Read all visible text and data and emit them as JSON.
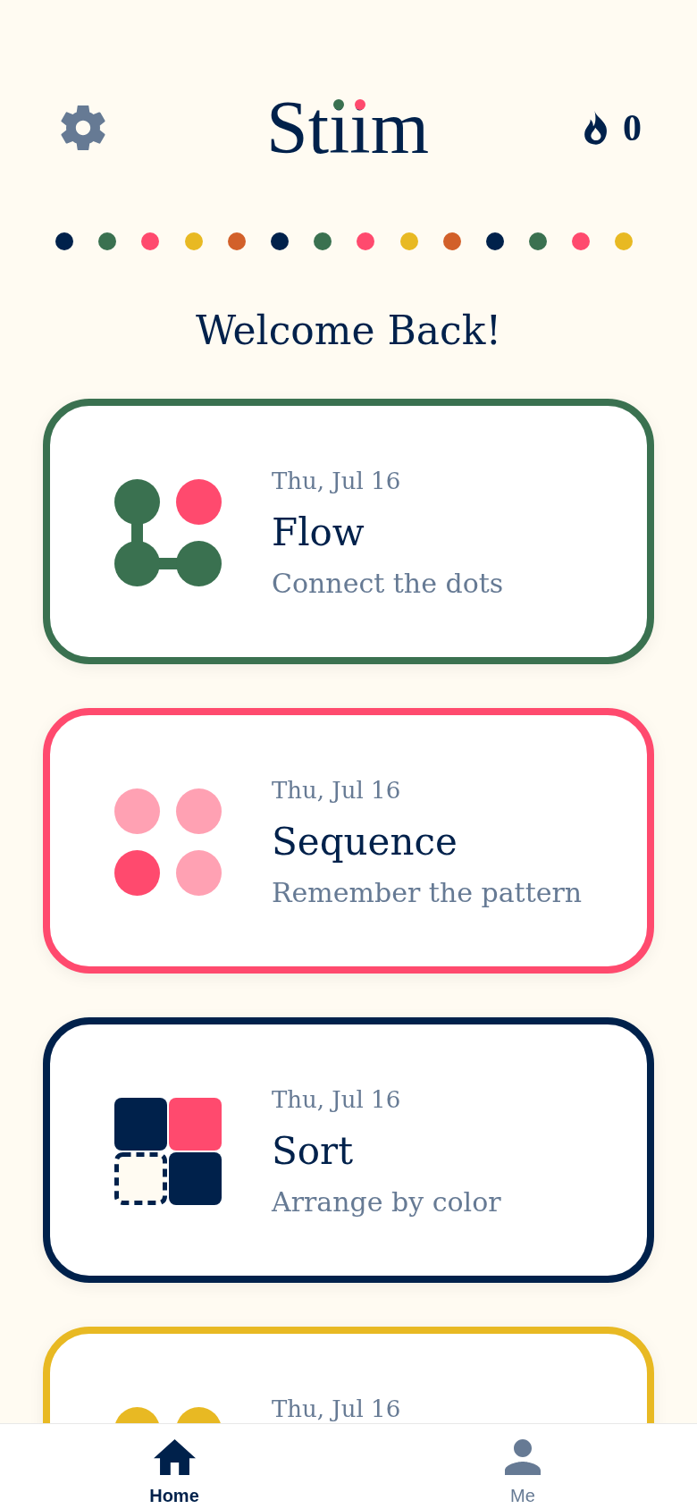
{
  "header": {
    "logo": "Stiim",
    "streak_count": "0"
  },
  "color_dots": [
    {
      "color": "#00214b"
    },
    {
      "color": "#3a7150"
    },
    {
      "color": "#ff4a6e"
    },
    {
      "color": "#e8b923"
    },
    {
      "color": "#d2602a"
    },
    {
      "color": "#00214b"
    },
    {
      "color": "#3a7150"
    },
    {
      "color": "#ff4a6e"
    },
    {
      "color": "#e8b923"
    },
    {
      "color": "#d2602a"
    },
    {
      "color": "#00214b"
    },
    {
      "color": "#3a7150"
    },
    {
      "color": "#ff4a6e"
    },
    {
      "color": "#e8b923"
    }
  ],
  "greeting": "Welcome Back!",
  "cards": [
    {
      "kind": "flow",
      "color": "#3a7150",
      "date": "Thu, Jul 16",
      "title": "Flow",
      "subtitle": "Connect the dots"
    },
    {
      "kind": "sequence",
      "color": "#ff4a6e",
      "date": "Thu, Jul 16",
      "title": "Sequence",
      "subtitle": "Remember the pattern"
    },
    {
      "kind": "sort",
      "color": "#00214b",
      "date": "Thu, Jul 16",
      "title": "Sort",
      "subtitle": "Arrange by color"
    },
    {
      "kind": "dots",
      "color": "#e8b923",
      "date": "Thu, Jul 16"
    }
  ],
  "bottom_nav": [
    {
      "kind": "home",
      "label": "Home",
      "selected": true
    },
    {
      "kind": "profile",
      "label": "Me",
      "selected": false
    }
  ]
}
